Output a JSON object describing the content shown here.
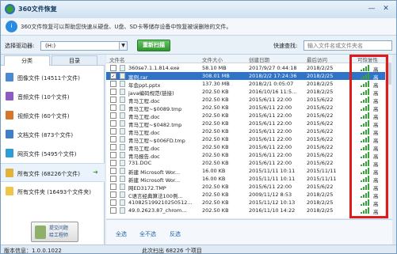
{
  "title": "360文件恢复",
  "window_controls": [
    "—",
    "✕"
  ],
  "banner": {
    "icon": "info-icon",
    "text": "360文件恢复可以帮助您快速从硬盘、U盘、SD卡等储存设备中恢复被误删除的文件。"
  },
  "drive": {
    "label": "选择驱动器:",
    "value": "(H:)",
    "rescan": "重新扫描"
  },
  "search": {
    "label": "快速查找:",
    "placeholder": "输入文件名或文件夹名"
  },
  "tabs": [
    "分类",
    "目录"
  ],
  "categories": [
    {
      "label": "图像文件 (14511个文件)",
      "icon": "image-icon",
      "color": "#4a8ad0"
    },
    {
      "label": "音频文件 (10个文件)",
      "icon": "audio-icon",
      "color": "#8a5cc4"
    },
    {
      "label": "视频文件 (60个文件)",
      "icon": "video-icon",
      "color": "#d4762c"
    },
    {
      "label": "文档文件 (873个文件)",
      "icon": "document-icon",
      "color": "#3f7fc8"
    },
    {
      "label": "网页文件 (5495个文件)",
      "icon": "webpage-icon",
      "color": "#2e9cd6"
    },
    {
      "label": "所有文件 (68226个文件)",
      "icon": "all-files-icon",
      "color": "#e2b33a",
      "selected": true
    },
    {
      "label": "所有文件夹 (16493个文件夹)",
      "icon": "folder-icon",
      "color": "#f0c64a"
    }
  ],
  "help_button": "提交问题\n给工程师",
  "columns": [
    "文件名",
    "文件大小",
    "创建日期",
    "最后访问",
    "可恢复性"
  ],
  "files": [
    {
      "name": "360se7.1.1.814.exe",
      "size": "58.10 MB",
      "created": "2017/9/27 0:44:18",
      "accessed": "2018/2/25",
      "rec": "高",
      "checked": false,
      "sel": false
    },
    {
      "name": "案例.rar",
      "size": "308.01 MB",
      "created": "2018/2/2 17:24:36",
      "accessed": "2018/2/25",
      "rec": "高",
      "checked": true,
      "sel": true
    },
    {
      "name": "年会ppt.pptx",
      "size": "137.30 MB",
      "created": "2018/2/1 0:05:07",
      "accessed": "2018/2/25",
      "rec": "高",
      "checked": false,
      "sel": false
    },
    {
      "name": "java编码规范(链接)",
      "size": "202.50 KB",
      "created": "2016/10/16 11:5...",
      "accessed": "2018/2/25",
      "rec": "高",
      "checked": false,
      "sel": false
    },
    {
      "name": "青马工程.doc",
      "size": "202.50 KB",
      "created": "2015/6/11 22:00",
      "accessed": "2015/6/22",
      "rec": "高",
      "checked": false,
      "sel": false
    },
    {
      "name": "青马工程~$0089.tmp",
      "size": "202.50 KB",
      "created": "2015/6/11 22:00",
      "accessed": "2015/6/22",
      "rec": "高",
      "checked": false,
      "sel": false
    },
    {
      "name": "青马工程.doc",
      "size": "202.50 KB",
      "created": "2015/6/11 22:00",
      "accessed": "2015/6/22",
      "rec": "高",
      "checked": false,
      "sel": false
    },
    {
      "name": "青马工程~$0482.tmp",
      "size": "202.50 KB",
      "created": "2015/6/11 22:00",
      "accessed": "2015/6/22",
      "rec": "高",
      "checked": false,
      "sel": false
    },
    {
      "name": "青马工程.doc",
      "size": "202.50 KB",
      "created": "2015/6/11 22:00",
      "accessed": "2015/6/22",
      "rec": "高",
      "checked": false,
      "sel": false
    },
    {
      "name": "青马工程~$006FD.tmp",
      "size": "202.50 KB",
      "created": "2015/6/11 22:00",
      "accessed": "2015/6/22",
      "rec": "高",
      "checked": false,
      "sel": false
    },
    {
      "name": "青马工程.doc",
      "size": "202.50 KB",
      "created": "2015/6/11 22:00",
      "accessed": "2015/6/22",
      "rec": "高",
      "checked": false,
      "sel": false
    },
    {
      "name": "青马报告.doc",
      "size": "202.50 KB",
      "created": "2015/6/11 22:00",
      "accessed": "2015/6/22",
      "rec": "高",
      "checked": false,
      "sel": false
    },
    {
      "name": "731.DOC",
      "size": "202.50 KB",
      "created": "2015/6/11 22:00",
      "accessed": "2015/6/22",
      "rec": "高",
      "checked": false,
      "sel": false
    },
    {
      "name": "新建 Microsoft Wor...",
      "size": "16.00 KB",
      "created": "2015/11/11 10:11",
      "accessed": "2015/11/11",
      "rec": "高",
      "checked": false,
      "sel": false
    },
    {
      "name": "新建 Microsoft Wor...",
      "size": "16.00 KB",
      "created": "2015/11/11 10:11",
      "accessed": "2015/11/11",
      "rec": "高",
      "checked": false,
      "sel": false
    },
    {
      "name": "网ED3172.TMP",
      "size": "202.50 KB",
      "created": "2015/6/11 22:00",
      "accessed": "2015/6/22",
      "rec": "高",
      "checked": false,
      "sel": false
    },
    {
      "name": "C语言经典算法100例...",
      "size": "202.50 KB",
      "created": "2009/11/12 8:53",
      "accessed": "2018/2/25",
      "rec": "高",
      "checked": false,
      "sel": false
    },
    {
      "name": "410825199210250512...",
      "size": "202.50 KB",
      "created": "2015/11/12 10:13",
      "accessed": "2018/2/25",
      "rec": "高",
      "checked": false,
      "sel": false
    },
    {
      "name": "49.0.2623.87_chrom...",
      "size": "202.50 KB",
      "created": "2016/11/10 14:22",
      "accessed": "2018/2/25",
      "rec": "高",
      "checked": false,
      "sel": false
    }
  ],
  "footer": {
    "select_all": "全选",
    "select_none": "全不选",
    "invert": "反选"
  },
  "status": {
    "version": "版本信息：1.0.0.1022",
    "found": "此次扫出 68226 个项目"
  }
}
